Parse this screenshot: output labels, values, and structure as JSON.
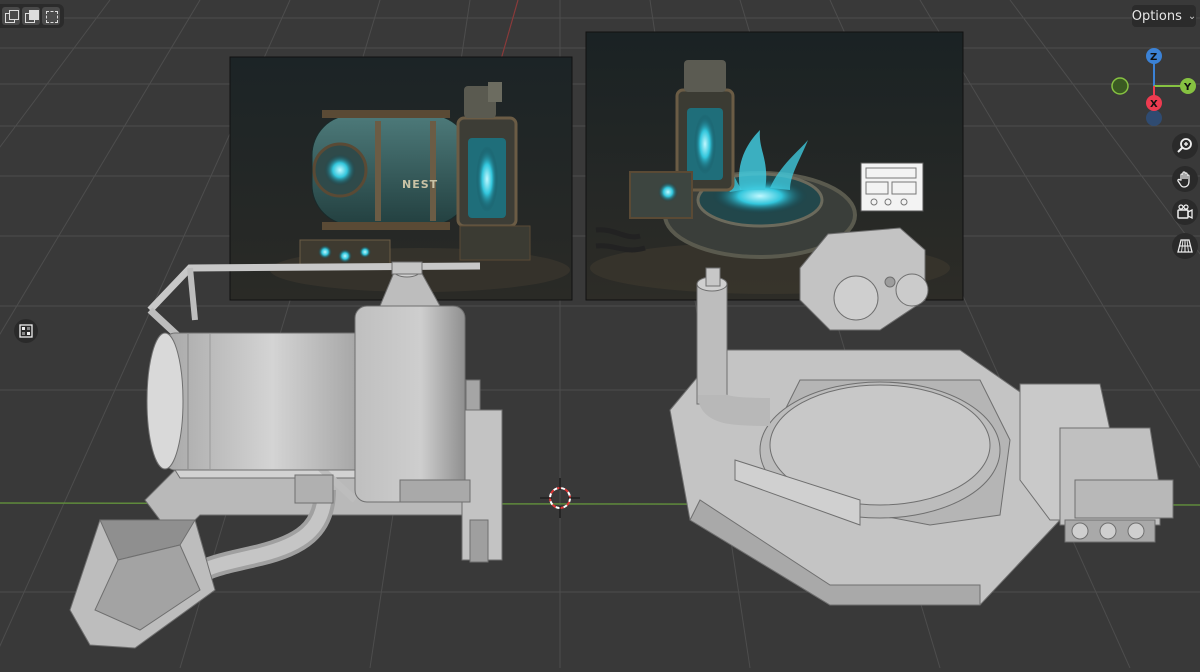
{
  "header": {
    "options_label": "Options"
  },
  "toolbar": {
    "select_modes": [
      "select-new-icon",
      "select-extend-icon",
      "select-subtract-icon"
    ]
  },
  "gizmo": {
    "z_label": "Z",
    "y_label": "Y",
    "x_label": "X",
    "colors": {
      "x": "#ed3b50",
      "y": "#86c241",
      "z": "#3b82d6"
    }
  },
  "navigation": {
    "buttons": [
      "zoom-icon",
      "hand-pan-icon",
      "camera-icon",
      "perspective-grid-icon"
    ]
  },
  "references": {
    "left_plate_label": "NEST"
  },
  "scene": {
    "x_axis_color": "#5f8a3c",
    "grid_color": "#4d4d4d"
  }
}
